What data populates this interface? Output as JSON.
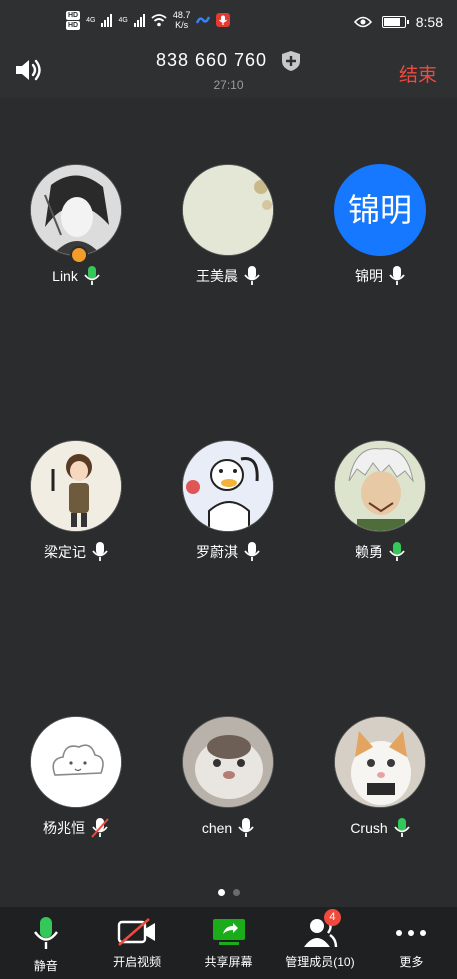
{
  "status_bar": {
    "hd1": "HD",
    "hd2": "HD",
    "net1": "4G",
    "net2": "4G",
    "speed_value": "48.7",
    "speed_unit": "K/s",
    "time": "8:58"
  },
  "header": {
    "meeting_id": "838 660 760",
    "elapsed": "27:10",
    "end_label": "结束"
  },
  "participants": [
    {
      "name": "Link",
      "mic": "active"
    },
    {
      "name": "王美晨",
      "mic": "idle"
    },
    {
      "name": "锦明",
      "avatar_text": "锦明",
      "mic": "idle"
    },
    {
      "name": "梁定记",
      "mic": "idle"
    },
    {
      "name": "罗蔚淇",
      "mic": "idle"
    },
    {
      "name": "赖勇",
      "mic": "active"
    },
    {
      "name": "杨兆恒",
      "mic": "muted"
    },
    {
      "name": "chen",
      "mic": "idle"
    },
    {
      "name": "Crush",
      "mic": "active"
    }
  ],
  "page_indicator": {
    "total": 2,
    "current": 1
  },
  "toolbar": {
    "mute_label": "静音",
    "video_label": "开启视频",
    "share_label": "共享屏幕",
    "members_label": "管理成员(10)",
    "members_badge": "4",
    "more_label": "更多"
  },
  "colors": {
    "background": "#2b2c2e",
    "end_red": "#f04a3e",
    "mic_green": "#34c759",
    "share_green": "#1aad19",
    "avatar_blue": "#1677ff"
  }
}
